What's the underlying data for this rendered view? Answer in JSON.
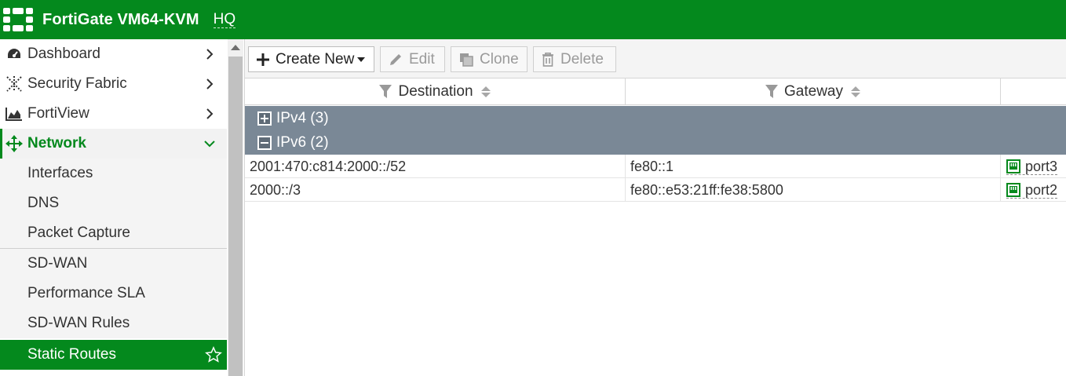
{
  "header": {
    "app_title": "FortiGate VM64-KVM",
    "hostname": "HQ",
    "accent_color": "#04891d"
  },
  "sidebar": {
    "items": [
      {
        "label": "Dashboard",
        "icon": "dashboard-icon"
      },
      {
        "label": "Security Fabric",
        "icon": "security-fabric-icon"
      },
      {
        "label": "FortiView",
        "icon": "fortiview-icon"
      },
      {
        "label": "Network",
        "icon": "network-icon",
        "expanded": true
      }
    ],
    "network_sub": [
      {
        "label": "Interfaces"
      },
      {
        "label": "DNS"
      },
      {
        "label": "Packet Capture"
      },
      {
        "label": "SD-WAN"
      },
      {
        "label": "Performance SLA"
      },
      {
        "label": "SD-WAN Rules"
      },
      {
        "label": "Static Routes",
        "active": true
      }
    ]
  },
  "toolbar": {
    "create_new": "Create New",
    "edit": "Edit",
    "clone": "Clone",
    "delete": "Delete"
  },
  "table": {
    "columns": [
      "Destination",
      "Gateway"
    ],
    "groups": [
      {
        "label": "IPv4 (3)",
        "collapsed": true
      },
      {
        "label": "IPv6 (2)",
        "collapsed": false
      }
    ],
    "rows": [
      {
        "destination": "2001:470:c814:2000::/52",
        "gateway": "fe80::1",
        "interface": "port3"
      },
      {
        "destination": "2000::/3",
        "gateway": "fe80::e53:21ff:fe38:5800",
        "interface": "port2"
      }
    ]
  }
}
